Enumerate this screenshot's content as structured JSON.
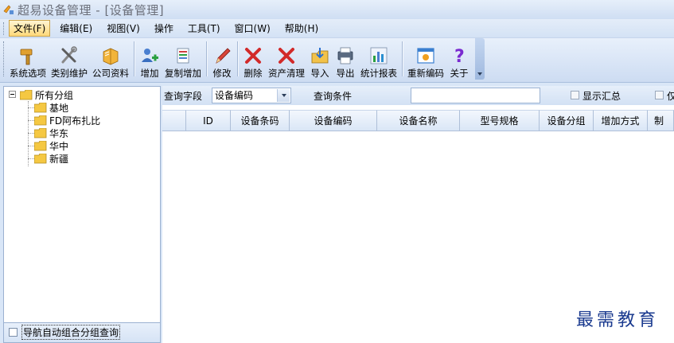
{
  "window": {
    "title": "超易设备管理 - [设备管理]"
  },
  "menu": [
    {
      "label": "文件(F)",
      "active": true
    },
    {
      "label": "编辑(E)"
    },
    {
      "label": "视图(V)"
    },
    {
      "label": "操作"
    },
    {
      "label": "工具(T)"
    },
    {
      "label": "窗口(W)"
    },
    {
      "label": "帮助(H)"
    }
  ],
  "toolbar": {
    "system_options": "系统选项",
    "category_maintain": "类别维护",
    "company_info": "公司资料",
    "add": "增加",
    "copy_add": "复制增加",
    "edit": "修改",
    "delete": "删除",
    "asset_clear": "资产清理",
    "import": "导入",
    "export": "导出",
    "stats_report": "统计报表",
    "recode": "重新编码",
    "about": "关于"
  },
  "tree": {
    "root": "所有分组",
    "children": [
      "基地",
      "FD阿布扎比",
      "华东",
      "华中",
      "新疆"
    ]
  },
  "left_footer": {
    "auto_group_query": "导航自动组合分组查询"
  },
  "query": {
    "field_label": "查询字段",
    "field_value": "设备编码",
    "condition_label": "查询条件",
    "condition_value": "",
    "show_summary": "显示汇总",
    "extra_check_label": "仅"
  },
  "grid": {
    "columns": [
      "ID",
      "设备条码",
      "设备编码",
      "设备名称",
      "型号规格",
      "设备分组",
      "增加方式",
      "制"
    ]
  },
  "watermark": "最需教育",
  "colors": {
    "folder": "#f5c842",
    "delete_red": "#d22a2a",
    "accent_blue": "#1a3a8f"
  }
}
